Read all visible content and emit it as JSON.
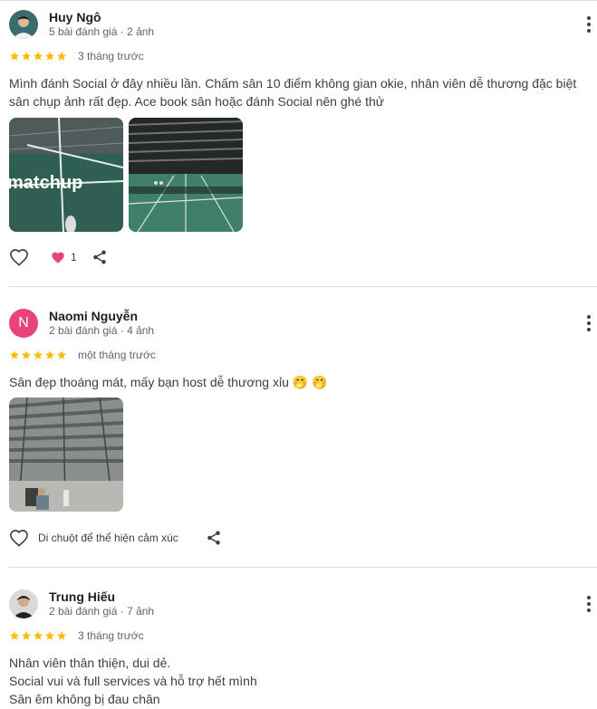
{
  "reviews": [
    {
      "name": "Huy Ngô",
      "meta": "5 bài đánh giá · 2 ảnh",
      "rating": 5,
      "time": "3 tháng trước",
      "text": "Mình đánh Social ở đây nhiều lần. Chấm sân 10 điểm không gian okie, nhân viên dễ thương đặc biệt sân chụp ảnh rất đẹp. Ace book sân hoặc đánh Social nên ghé thử",
      "photo_text": "matchup",
      "reaction_count": "1",
      "avatar": "profile-photo"
    },
    {
      "name": "Naomi Nguyễn",
      "meta": "2 bài đánh giá · 4 ảnh",
      "rating": 5,
      "time": "một tháng trước",
      "text": "Sân đẹp thoáng mát, mấy bạn host dễ thương xỉu 🤭 🤭",
      "avatar_letter": "N",
      "avatar_color": "#e8437b",
      "react_label": "Di chuột để thể hiện cảm xúc"
    },
    {
      "name": "Trung Hiếu",
      "meta": "2 bài đánh giá · 7 ảnh",
      "rating": 5,
      "time": "3 tháng trước",
      "text_lines": [
        "Nhân viên thân thiện, dui dẻ.",
        "Social vui và full services và hỗ trợ hết mình",
        "Sân êm không bị đau chân"
      ],
      "avatar": "profile-photo"
    }
  ],
  "colors": {
    "star": "#fbbc04",
    "heart_filled": "#e8437b",
    "divider": "#dadce0"
  },
  "icons": [
    "heart-outline-icon",
    "heart-filled-icon",
    "share-icon",
    "more-vert-icon",
    "star-icon"
  ]
}
